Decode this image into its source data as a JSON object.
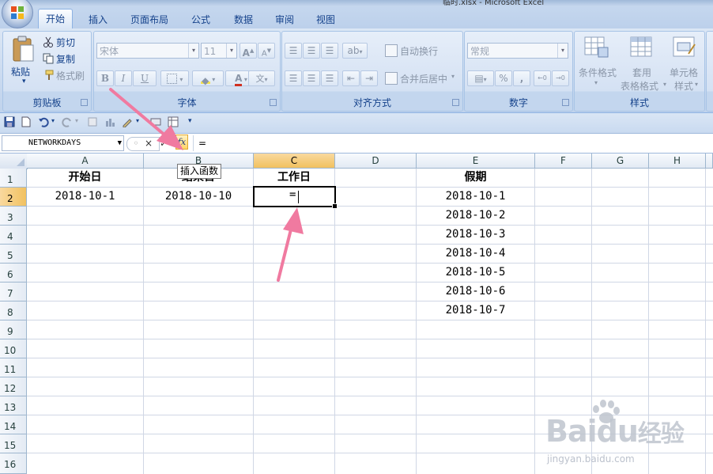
{
  "window": {
    "title": "临时.xlsx - Microsoft Excel"
  },
  "tabs": [
    {
      "label": "开始",
      "active": true
    },
    {
      "label": "插入"
    },
    {
      "label": "页面布局"
    },
    {
      "label": "公式"
    },
    {
      "label": "数据"
    },
    {
      "label": "审阅"
    },
    {
      "label": "视图"
    }
  ],
  "ribbon": {
    "clipboard": {
      "label": "剪贴板",
      "paste": "粘贴",
      "cut": "剪切",
      "copy": "复制",
      "format_painter": "格式刷"
    },
    "font": {
      "label": "字体",
      "font_name": "宋体",
      "font_size": "11",
      "bold": "B",
      "italic": "I",
      "underline": "U",
      "grow": "A",
      "shrink": "A"
    },
    "alignment": {
      "label": "对齐方式",
      "wrap_text": "自动换行",
      "merge_center": "合并后居中"
    },
    "number": {
      "label": "数字",
      "format": "常规",
      "percent": "%",
      "comma": ","
    },
    "styles": {
      "label": "样式",
      "conditional": "条件格式",
      "table_format_1": "套用",
      "table_format_2": "表格格式",
      "cell_style_1": "单元格",
      "cell_style_2": "样式"
    }
  },
  "formula_bar": {
    "name_box": "NETWORKDAYS",
    "cancel": "×",
    "enter": "✓",
    "fx": "fx",
    "formula": "="
  },
  "tooltip": "插入函数",
  "columns": [
    "A",
    "B",
    "C",
    "D",
    "E",
    "F",
    "G",
    "H"
  ],
  "rows": [
    "1",
    "2",
    "3",
    "4",
    "5",
    "6",
    "7",
    "8",
    "9",
    "10",
    "11",
    "12",
    "13",
    "14",
    "15",
    "16"
  ],
  "cells": {
    "A1": "开始日",
    "B1": "结束日",
    "C1": "工作日",
    "E1": "假期",
    "A2": "2018-10-1",
    "B2": "2018-10-10",
    "C2": "=",
    "E2": "2018-10-1",
    "E3": "2018-10-2",
    "E4": "2018-10-3",
    "E5": "2018-10-4",
    "E6": "2018-10-5",
    "E7": "2018-10-6",
    "E8": "2018-10-7"
  },
  "watermark": {
    "brand": "Baidu",
    "cn": "经验",
    "url": "jingyan.baidu.com"
  },
  "colors": {
    "ribbon": "#c4d6ee",
    "selected_header": "#f1c15f",
    "annotation_arrow": "#f0709a"
  }
}
